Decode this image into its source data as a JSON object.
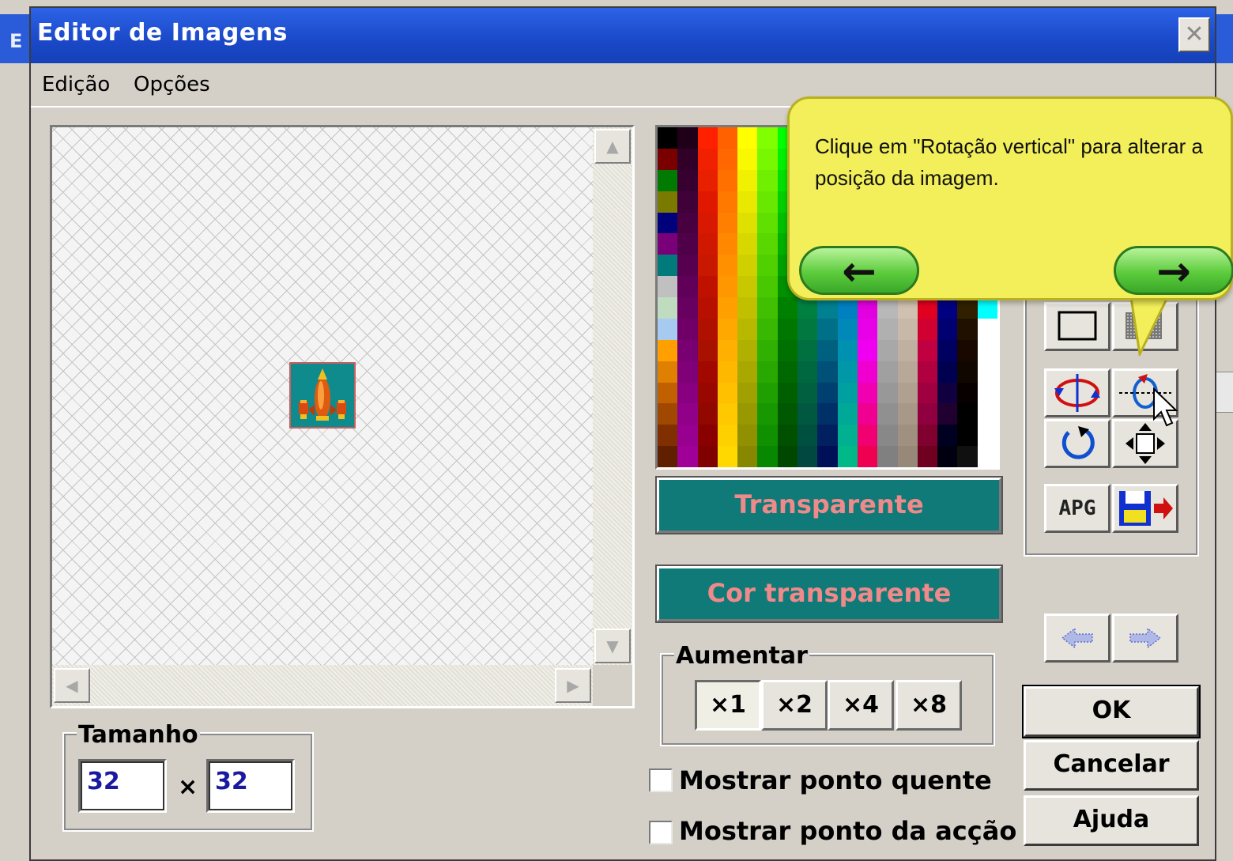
{
  "window": {
    "title": "Editor de Imagens",
    "close_glyph": "✕",
    "bg_title_letter": "E"
  },
  "menu": {
    "items": [
      "Edição",
      "Opções"
    ]
  },
  "canvas": {
    "scroll_up": "▲",
    "scroll_down": "▼",
    "scroll_left": "◀",
    "scroll_right": "▶",
    "sprite_icon": "rocket-icon"
  },
  "color_bars": {
    "primary": "Transparente",
    "secondary": "Cor transparente",
    "accent_bg": "#0f7a78",
    "accent_text": "#f08a8a"
  },
  "zoom": {
    "label": "Aumentar",
    "options": [
      "×1",
      "×2",
      "×4",
      "×8"
    ],
    "selected": "×1"
  },
  "size": {
    "label": "Tamanho",
    "width": "32",
    "height": "32",
    "separator": "×"
  },
  "checkboxes": [
    {
      "label": "Mostrar ponto quente",
      "checked": false
    },
    {
      "label": "Mostrar ponto da acção",
      "checked": false
    }
  ],
  "tools": {
    "apg_label": "APG"
  },
  "actions": {
    "ok": "OK",
    "cancel": "Cancelar",
    "help": "Ajuda"
  },
  "tooltip": {
    "text": "Clique em \"Rotação vertical\" para alterar a posição da imagem.",
    "prev": "←",
    "next": "→"
  }
}
